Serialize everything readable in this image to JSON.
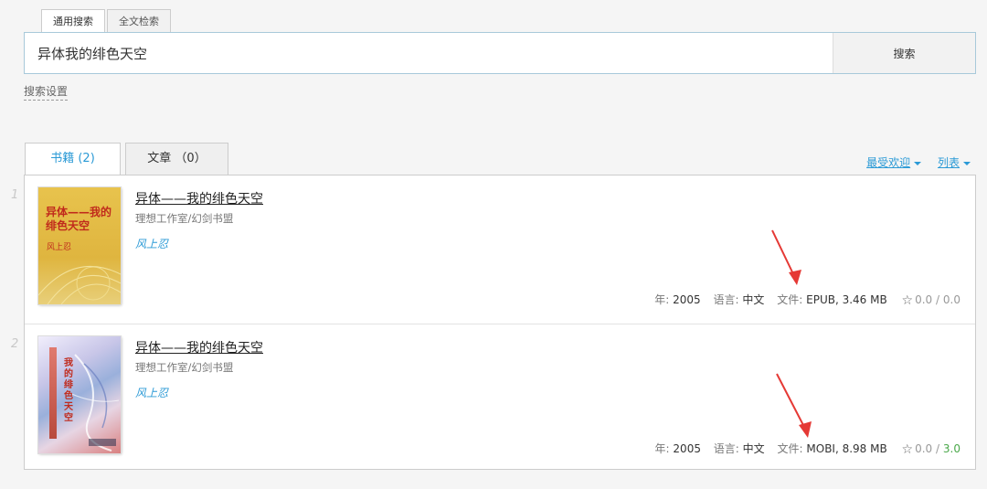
{
  "search": {
    "tabs": [
      {
        "label": "通用搜索"
      },
      {
        "label": "全文检索"
      }
    ],
    "query": "异体我的绯色天空",
    "button_label": "搜索",
    "settings_label": "搜索设置"
  },
  "results_tabs": [
    {
      "label": "书籍 (2)"
    },
    {
      "label": "文章 （0）"
    }
  ],
  "sort": {
    "order_label": "最受欢迎",
    "view_label": "列表"
  },
  "results": [
    {
      "index": "1",
      "title": "异体——我的绯色天空",
      "publisher": "理想工作室/幻剑书盟",
      "author": "风上忍",
      "cover_title": "异体——我的绯色天空",
      "cover_author": "风上忍",
      "year_label": "年:",
      "year": "2005",
      "language_label": "语言:",
      "language": "中文",
      "file_label": "文件:",
      "file": "EPUB, 3.46 MB",
      "rating_a": "0.0",
      "rating_sep": "/",
      "rating_b": "0.0"
    },
    {
      "index": "2",
      "title": "异体——我的绯色天空",
      "publisher": "理想工作室/幻剑书盟",
      "author": "风上忍",
      "cover_title": "我的绯色天空",
      "year_label": "年:",
      "year": "2005",
      "language_label": "语言:",
      "language": "中文",
      "file_label": "文件:",
      "file": "MOBI, 8.98 MB",
      "rating_a": "0.0",
      "rating_sep": "/",
      "rating_b": "3.0"
    }
  ],
  "colors": {
    "accent": "#2b9ad6",
    "annotation_arrow": "#e53935",
    "rating_positive": "#4aa84a"
  }
}
